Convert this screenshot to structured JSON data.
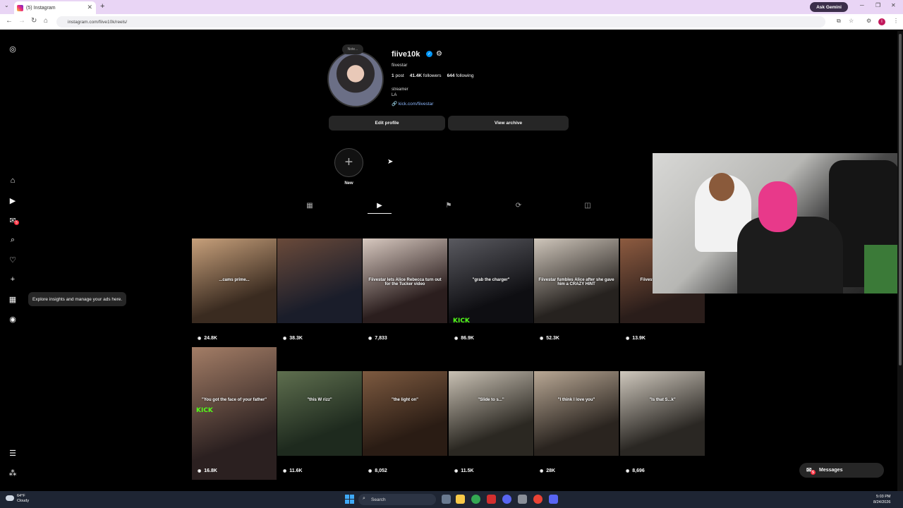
{
  "browser": {
    "tab_title": "(5) Instagram",
    "url": "instagram.com/fiive10k/reels/",
    "ask_gemini": "Ask Gemini",
    "profile_initial": "I"
  },
  "sidebar": {
    "tooltip": "Explore insights and manage your ads here.",
    "notifications_badge": "5"
  },
  "profile": {
    "note": "Note...",
    "username": "fiive10k",
    "full_name": "fiivestar",
    "posts_count": "1",
    "posts_label": "post",
    "followers_count": "41.4K",
    "followers_label": "followers",
    "following_count": "644",
    "following_label": "following",
    "bio_line1": "streamer",
    "bio_line2": "LA",
    "link": "kick.com/fiivestar",
    "edit_profile": "Edit profile",
    "view_archive": "View archive",
    "new_highlight": "New"
  },
  "reels": [
    {
      "views": "24.8K",
      "caption": "...cams prime..."
    },
    {
      "views": "38.3K",
      "caption": ""
    },
    {
      "views": "7,833",
      "caption": "Fiivestar lets Alice Rebecca turn out for the Tucker video"
    },
    {
      "views": "86.9K",
      "caption": "\"grab the charger\""
    },
    {
      "views": "52.3K",
      "caption": "Fiivestar fumbles Alice after she gave him a CRAZY HINT"
    },
    {
      "views": "13.9K",
      "caption": "Fiivesta N3on & at her"
    },
    {
      "views": "16.8K",
      "caption": "\"You got the face of your father\""
    },
    {
      "views": "11.6K",
      "caption": "\"this W rizz\""
    },
    {
      "views": "8,052",
      "caption": "\"the light on\""
    },
    {
      "views": "11.5K",
      "caption": "\"Slide to s...\""
    },
    {
      "views": "28K",
      "caption": "\"I think I love you\""
    },
    {
      "views": "8,696",
      "caption": "\"Is that S...k\""
    }
  ],
  "kick_label": "KICK",
  "messages": {
    "label": "Messages",
    "badge": "5"
  },
  "taskbar": {
    "temp": "64°F",
    "condition": "Cloudy",
    "search": "Search",
    "time": "5:03 PM",
    "date": "8/24/2026"
  }
}
